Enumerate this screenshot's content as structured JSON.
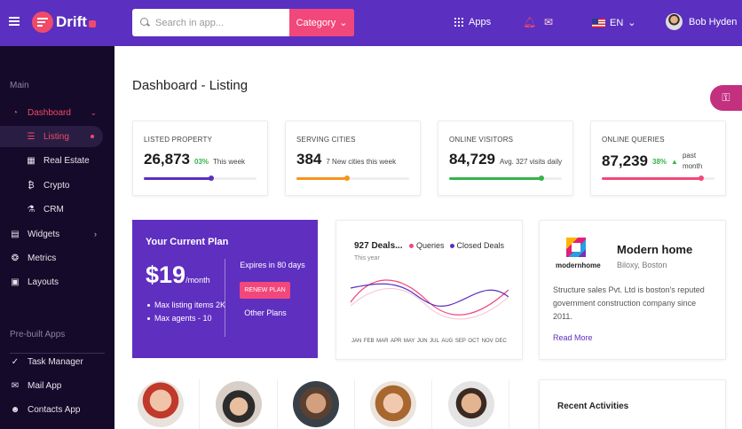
{
  "header": {
    "brand": "Drift",
    "search_placeholder": "Search in app...",
    "category_label": "Category",
    "apps_label": "Apps",
    "language": "EN",
    "user_name": "Bob Hyden"
  },
  "sidebar": {
    "main_title": "Main",
    "prebuilt_title": "Pre-built Apps",
    "items": [
      {
        "label": "Dashboard",
        "icon": "speedometer-icon"
      },
      {
        "label": "Listing",
        "icon": "list-icon"
      },
      {
        "label": "Real Estate",
        "icon": "building-icon"
      },
      {
        "label": "Crypto",
        "icon": "bitcoin-icon"
      },
      {
        "label": "CRM",
        "icon": "flask-icon"
      },
      {
        "label": "Widgets",
        "icon": "widgets-icon"
      },
      {
        "label": "Metrics",
        "icon": "metrics-icon"
      },
      {
        "label": "Layouts",
        "icon": "layout-icon"
      }
    ],
    "apps": [
      {
        "label": "Task Manager",
        "icon": "check-circle-icon"
      },
      {
        "label": "Mail App",
        "icon": "mail-icon"
      },
      {
        "label": "Contacts App",
        "icon": "contacts-icon"
      }
    ]
  },
  "page": {
    "title": "Dashboard - Listing"
  },
  "stats": [
    {
      "label": "LISTED PROPERTY",
      "value": "26,873",
      "pct": "03%",
      "note": "This week",
      "progress": 0.6,
      "color": "#5b2fbf"
    },
    {
      "label": "SERVING CITIES",
      "value": "384",
      "pct": "",
      "note": "7 New cities this week",
      "progress": 0.45,
      "color": "#f7941d"
    },
    {
      "label": "ONLINE VISITORS",
      "value": "84,729",
      "pct": "",
      "note": "Avg. 327 visits daily",
      "progress": 0.82,
      "color": "#35b34a"
    },
    {
      "label": "ONLINE QUERIES",
      "value": "87,239",
      "pct": "38%",
      "note": "past month",
      "progress": 0.88,
      "color": "#f2477a"
    }
  ],
  "plan": {
    "title": "Your Current Plan",
    "price": "$19",
    "per": "/month",
    "features": [
      "Max listing items 2K",
      "Max agents - 10"
    ],
    "expires": "Expires in 80 days",
    "renew_label": "RENEW PLAN",
    "other_label": "Other Plans"
  },
  "deals": {
    "title": "927 Deals...",
    "subtitle": "This year",
    "legend": [
      {
        "name": "Queries",
        "color": "#f2477a"
      },
      {
        "name": "Closed Deals",
        "color": "#5b2fbf"
      }
    ],
    "months": [
      "JAN",
      "FEB",
      "MAR",
      "APR",
      "MAY",
      "JUN",
      "JUL",
      "AUG",
      "SEP",
      "OCT",
      "NOV",
      "DEC"
    ]
  },
  "company": {
    "logo_word": "modernhome",
    "name": "Modern home",
    "location": "Biloxy, Boston",
    "description": "Structure sales Pvt. Ltd is boston's reputed government construction company since 2011.",
    "link": "Read More"
  },
  "recent": {
    "title": "Recent Activities"
  },
  "colors": {
    "header": "#5b2fbf",
    "sidebar": "#150a29",
    "accent": "#f2477a",
    "plan": "#5f2fc0"
  }
}
